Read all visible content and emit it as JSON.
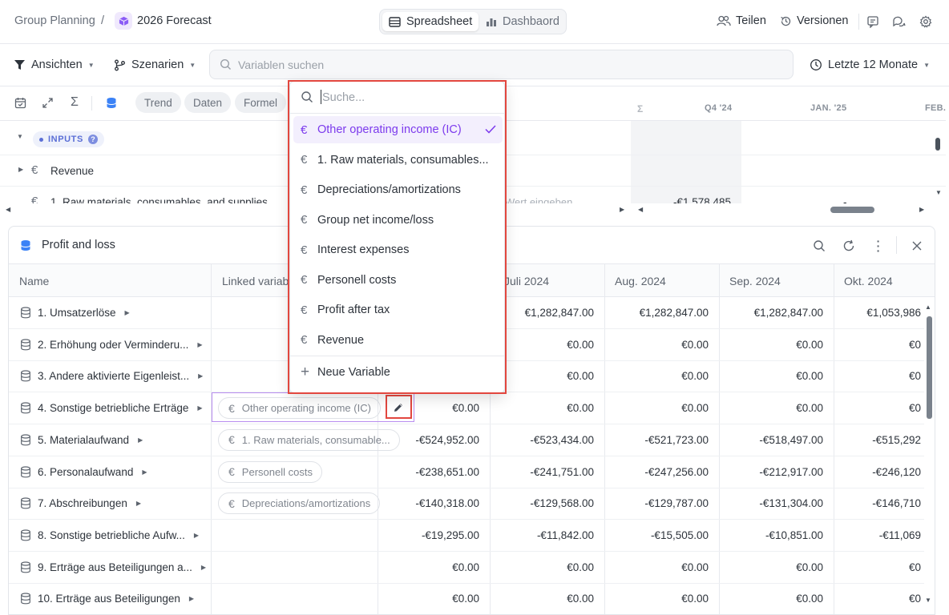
{
  "breadcrumb": {
    "root": "Group Planning",
    "separator": "/",
    "current": "2026 Forecast"
  },
  "view_toggle": {
    "spreadsheet": "Spreadsheet",
    "dashboard": "Dashbaord"
  },
  "top_right": {
    "share": "Teilen",
    "versions": "Versionen"
  },
  "toolbar": {
    "views": "Ansichten",
    "scenarios": "Szenarien",
    "search_placeholder": "Variablen suchen",
    "period": "Letzte 12 Monate"
  },
  "toolbar2": {
    "chips": [
      "Trend",
      "Daten",
      "Formel"
    ]
  },
  "upper_grid": {
    "col_sum": "Σ",
    "col_q4": "Q4 '24",
    "col_jan": "JAN. '25",
    "col_feb": "FEB.",
    "section": "INPUTS",
    "section_help": "?",
    "rows": [
      {
        "label": "Revenue"
      },
      {
        "label": "1. Raw materials, consumables, and supplies",
        "input_hint": "Wert eingeben",
        "q4": "-€1,578,485",
        "jan": "-"
      }
    ]
  },
  "panel": {
    "title": "Profit and loss",
    "columns": [
      "Name",
      "Linked variable",
      "Juli 2024",
      "Aug. 2024",
      "Sep. 2024",
      "Okt. 2024"
    ],
    "rows": [
      {
        "name": "1. Umsatzerlöse",
        "link": "",
        "values": [
          "€1,282,847.00",
          "€1,282,847.00",
          "€1,282,847.00",
          "€1,053,986"
        ]
      },
      {
        "name": "2. Erhöhung oder Verminderu...",
        "link": "",
        "values": [
          "€0.00",
          "€0.00",
          "€0.00",
          "€0"
        ]
      },
      {
        "name": "3. Andere aktivierte Eigenleist...",
        "link": "",
        "values": [
          "€0.00",
          "€0.00",
          "€0.00",
          "€0"
        ]
      },
      {
        "name": "4. Sonstige betriebliche Erträge",
        "link": "Other operating income (IC)",
        "first": "€0.00",
        "values": [
          "€0.00",
          "€0.00",
          "€0.00",
          "€0"
        ]
      },
      {
        "name": "5. Materialaufwand",
        "link": "1. Raw materials, consumable...",
        "first": "-€524,952.00",
        "values": [
          "-€523,434.00",
          "-€521,723.00",
          "-€518,497.00",
          "-€515,292"
        ]
      },
      {
        "name": "6. Personalaufwand",
        "link": "Personell costs",
        "first": "-€238,651.00",
        "values": [
          "-€241,751.00",
          "-€247,256.00",
          "-€212,917.00",
          "-€246,120"
        ]
      },
      {
        "name": "7. Abschreibungen",
        "link": "Depreciations/amortizations",
        "first": "-€140,318.00",
        "values": [
          "-€129,568.00",
          "-€129,787.00",
          "-€131,304.00",
          "-€146,710"
        ]
      },
      {
        "name": "8. Sonstige betriebliche Aufw...",
        "link": "",
        "first": "-€19,295.00",
        "values": [
          "-€11,842.00",
          "-€15,505.00",
          "-€10,851.00",
          "-€11,069"
        ]
      },
      {
        "name": "9. Erträge aus Beteiligungen a...",
        "link": "",
        "first": "€0.00",
        "values": [
          "€0.00",
          "€0.00",
          "€0.00",
          "€0"
        ]
      },
      {
        "name": "10. Erträge aus Beteiligungen",
        "link": "",
        "first": "€0.00",
        "values": [
          "€0.00",
          "€0.00",
          "€0.00",
          "€0"
        ]
      }
    ]
  },
  "dropdown": {
    "search_placeholder": "Suche...",
    "items": [
      "Other operating income (IC)",
      "1. Raw materials, consumables...",
      "Depreciations/amortizations",
      "Group net income/loss",
      "Interest expenses",
      "Personell costs",
      "Profit after tax",
      "Revenue"
    ],
    "selected_index": 0,
    "new_variable": "Neue Variable"
  },
  "colors": {
    "accent": "#7c3aed",
    "highlight": "#e2473f",
    "link_blue": "#3b82f6"
  }
}
